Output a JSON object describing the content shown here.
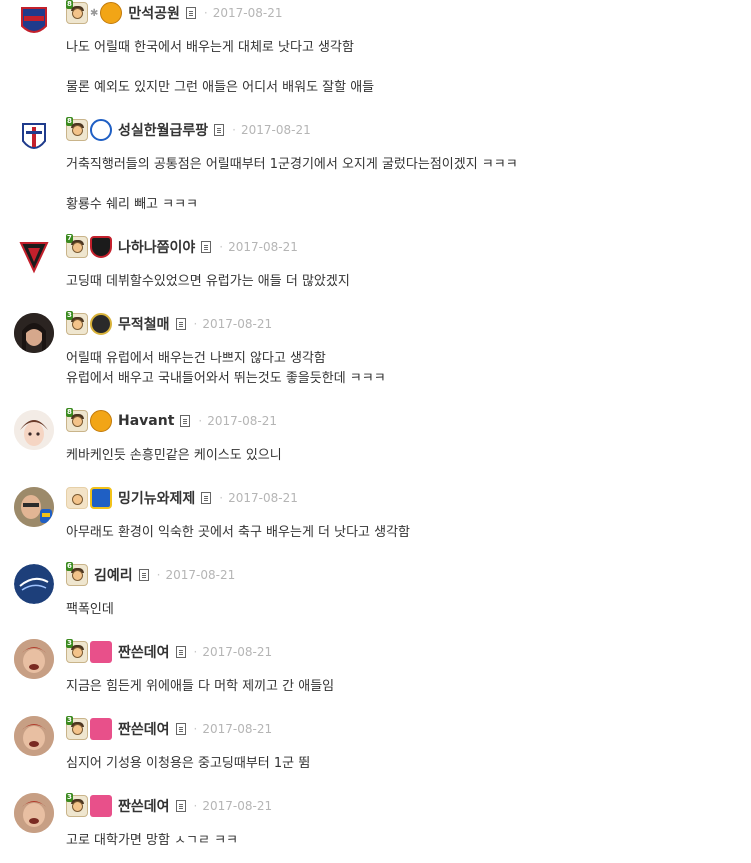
{
  "comments": [
    {
      "nickname": "만석공원",
      "date": "2017-08-21",
      "level": "8",
      "lines": [
        "나도 어릴때 한국에서 배우는게 대체로 낫다고 생각함",
        "물론 예외도 있지만 그런 애들은 어디서 배워도 잘할 애들"
      ]
    },
    {
      "nickname": "성실한월급루팡",
      "date": "2017-08-21",
      "level": "8",
      "lines": [
        "거축직행러들의 공통점은 어릴때부터 1군경기에서 오지게 굴렀다는점이겠지 ㅋㅋㅋ",
        "황룡수 쉐리 빼고 ㅋㅋㅋ"
      ]
    },
    {
      "nickname": "나하나쯤이야",
      "date": "2017-08-21",
      "level": "7",
      "lines": [
        "고딩때 데뷔할수있었으면 유럽가는 애들 더 많았겠지"
      ]
    },
    {
      "nickname": "무적철매",
      "date": "2017-08-21",
      "level": "3",
      "lines": [
        "어릴때 유럽에서 배우는건 나쁘지 않다고 생각함",
        "유럽에서 배우고 국내들어와서 뛰는것도 좋을듯한데 ㅋㅋㅋ"
      ]
    },
    {
      "nickname": "Havant",
      "date": "2017-08-21",
      "level": "8",
      "lines": [
        "케바케인듯 손흥민같은 케이스도 있으니"
      ]
    },
    {
      "nickname": "밍기뉴와제제",
      "date": "2017-08-21",
      "level": "",
      "lines": [
        "아무래도 환경이 익숙한 곳에서 축구 배우는게 더 낫다고 생각함"
      ]
    },
    {
      "nickname": "김예리",
      "date": "2017-08-21",
      "level": "6",
      "lines": [
        "팩폭인데"
      ]
    },
    {
      "nickname": "짠쓴데여",
      "date": "2017-08-21",
      "level": "3",
      "lines": [
        "지금은 힘든게 위에애들 다 머학 제끼고 간 애들임"
      ]
    },
    {
      "nickname": "짠쓴데여",
      "date": "2017-08-21",
      "level": "3",
      "lines": [
        "심지어 기성용 이청용은 중고딩때부터 1군 뜀"
      ]
    },
    {
      "nickname": "짠쓴데여",
      "date": "2017-08-21",
      "level": "3",
      "lines": [
        "고로 대학가면 망함 ㅅㄱㄹ ㅋㅋ"
      ]
    }
  ],
  "colors": {
    "text": "#333333",
    "date": "#b5b5b5",
    "level_badge": "#3b8a1f"
  }
}
